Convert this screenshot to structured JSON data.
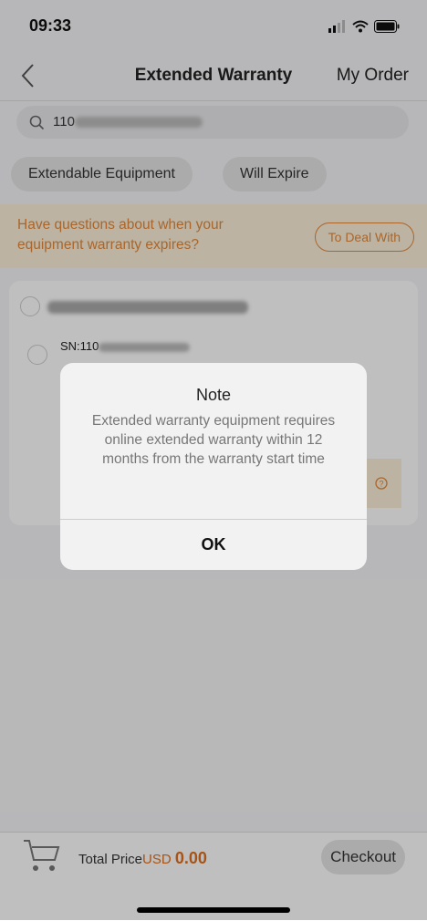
{
  "status": {
    "time": "09:33"
  },
  "nav": {
    "title": "Extended Warranty",
    "my_order": "My Order"
  },
  "search": {
    "value": "110"
  },
  "tabs": [
    {
      "label": "Extendable Equipment"
    },
    {
      "label": "Will Expire"
    }
  ],
  "banner": {
    "text": "Have questions about when your equipment warranty expires?",
    "button": "To Deal With"
  },
  "card": {
    "sn_prefix": "SN:110"
  },
  "bottom": {
    "total_label": "Total Price",
    "currency": "USD",
    "amount": "0.00",
    "checkout": "Checkout"
  },
  "dialog": {
    "title": "Note",
    "message": "Extended warranty equipment requires online extended warranty within 12 months from the warranty start time",
    "ok": "OK"
  },
  "colors": {
    "accent": "#e3883a",
    "price": "#e06f1c",
    "banner_bg": "#fbefd8"
  }
}
